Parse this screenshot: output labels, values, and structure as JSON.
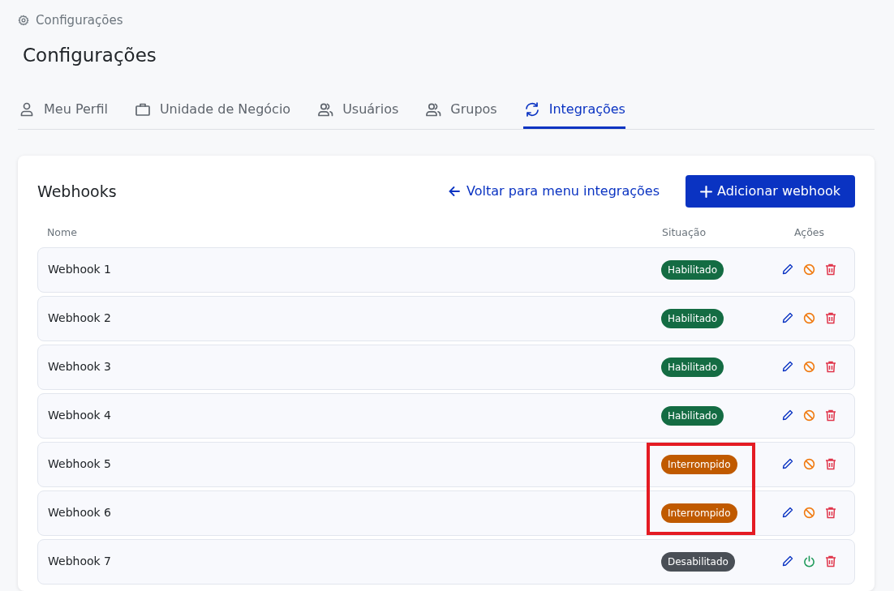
{
  "breadcrumb": "Configurações",
  "title": "Configurações",
  "tabs": [
    {
      "label": "Meu Perfil",
      "selected": false
    },
    {
      "label": "Unidade de Negócio",
      "selected": false
    },
    {
      "label": "Usuários",
      "selected": false
    },
    {
      "label": "Grupos",
      "selected": false
    },
    {
      "label": "Integrações",
      "selected": true
    }
  ],
  "panel": {
    "title": "Webhooks",
    "back_link": "Voltar para menu integrações",
    "add_button": "Adicionar webhook"
  },
  "table": {
    "columns": [
      "Nome",
      "Situação",
      "Ações"
    ],
    "rows": [
      {
        "name": "Webhook 1",
        "status": "Habilitado",
        "kind": "enabled",
        "highlighted": false
      },
      {
        "name": "Webhook 2",
        "status": "Habilitado",
        "kind": "enabled",
        "highlighted": false
      },
      {
        "name": "Webhook 3",
        "status": "Habilitado",
        "kind": "enabled",
        "highlighted": false
      },
      {
        "name": "Webhook 4",
        "status": "Habilitado",
        "kind": "enabled",
        "highlighted": false
      },
      {
        "name": "Webhook 5",
        "status": "Interrompido",
        "kind": "interrupted",
        "highlighted": true
      },
      {
        "name": "Webhook 6",
        "status": "Interrompido",
        "kind": "interrupted",
        "highlighted": true
      },
      {
        "name": "Webhook 7",
        "status": "Desabilitado",
        "kind": "disabled",
        "highlighted": false
      }
    ]
  }
}
